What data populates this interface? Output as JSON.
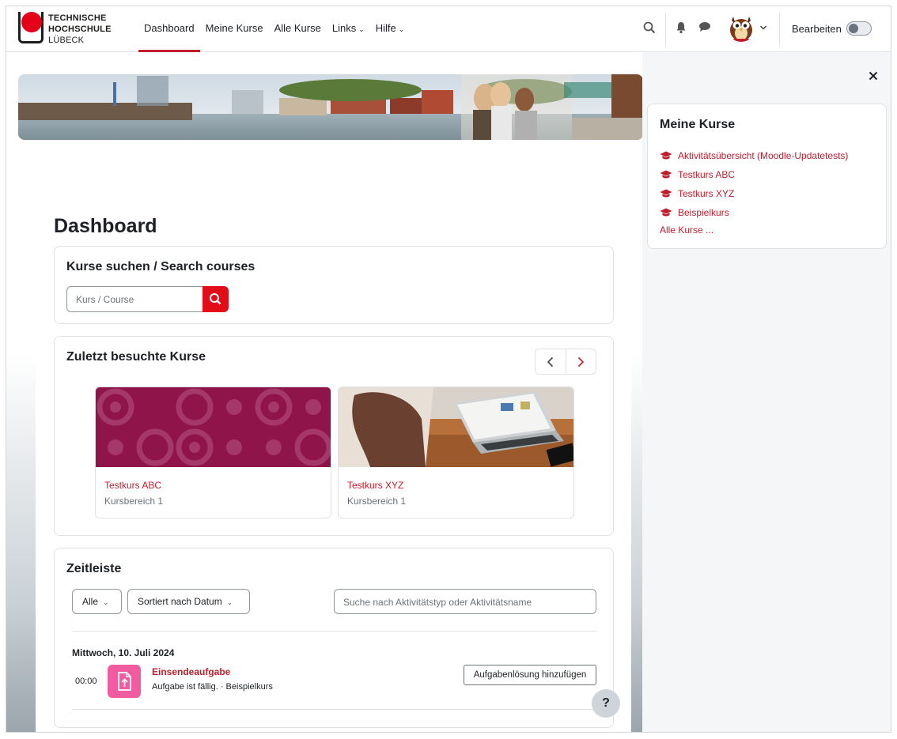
{
  "navbar": {
    "logo": {
      "line1": "TECHNISCHE",
      "line2": "HOCHSCHULE",
      "line3": "LÜBECK"
    },
    "items": [
      {
        "label": "Dashboard",
        "active": true
      },
      {
        "label": "Meine Kurse"
      },
      {
        "label": "Alle Kurse"
      },
      {
        "label": "Links",
        "dropdown": true
      },
      {
        "label": "Hilfe",
        "dropdown": true
      }
    ],
    "edit_label": "Bearbeiten",
    "edit_mode_on": false
  },
  "page": {
    "title": "Dashboard",
    "search_block": {
      "heading": "Kurse suchen / Search courses",
      "placeholder": "Kurs / Course"
    },
    "recent_block": {
      "heading": "Zuletzt besuchte Kurse",
      "courses": [
        {
          "name": "Testkurs ABC",
          "category": "Kursbereich 1"
        },
        {
          "name": "Testkurs XYZ",
          "category": "Kursbereich 1"
        }
      ]
    },
    "timeline_block": {
      "heading": "Zeitleiste",
      "filter_selected": "Alle",
      "sort_selected": "Sortiert nach Datum",
      "search_placeholder": "Suche nach Aktivitätstyp oder Aktivitätsname",
      "date": "Mittwoch, 10. Juli 2024",
      "events": [
        {
          "time": "00:00",
          "name": "Einsendeaufgabe",
          "description": "Aufgabe ist fällig. · Beispielkurs",
          "action": "Aufgabenlösung hinzufügen"
        }
      ]
    },
    "help_label": "?"
  },
  "drawer": {
    "heading": "Meine Kurse",
    "courses": [
      "Aktivitätsübersicht (Moodle-Updatetests)",
      "Testkurs ABC",
      "Testkurs XYZ",
      "Beispielkurs"
    ],
    "all_courses": "Alle Kurse ..."
  },
  "colors": {
    "brand_red": "#e20d19",
    "link_red": "#c11d2c",
    "assignment_pink": "#f15ba0",
    "drawer_bg": "#f5f6f7"
  },
  "icons": [
    "search-icon",
    "bell-icon",
    "chat-icon",
    "chevron-down-icon",
    "close-icon",
    "graduation-cap-icon",
    "chevron-left-icon",
    "chevron-right-icon",
    "file-upload-icon"
  ]
}
